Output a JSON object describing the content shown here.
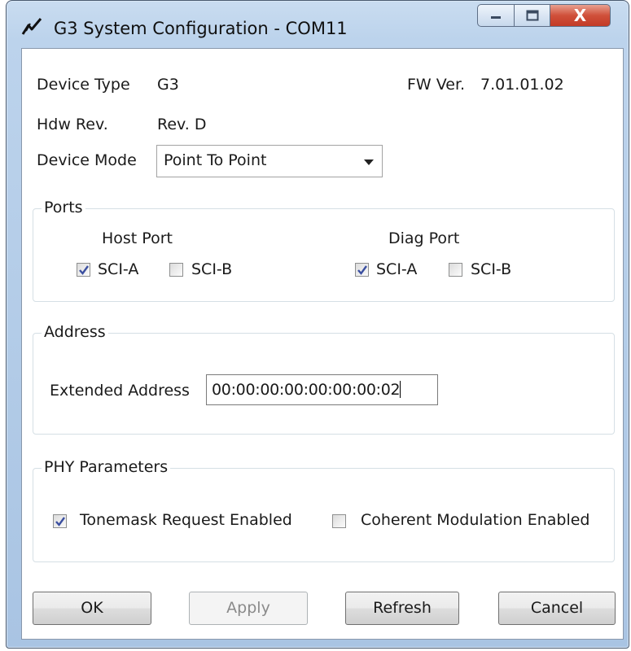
{
  "window": {
    "title": "G3 System Configuration - COM11",
    "close_glyph": "X"
  },
  "device": {
    "type_label": "Device Type",
    "type_value": "G3",
    "fw_label": "FW Ver.",
    "fw_value": "7.01.01.02",
    "hdw_label": "Hdw Rev.",
    "hdw_value": "Rev. D",
    "mode_label": "Device Mode",
    "mode_value": "Point To Point"
  },
  "ports": {
    "title": "Ports",
    "host": {
      "label": "Host Port",
      "sci_a": {
        "label": "SCI-A",
        "checked": true
      },
      "sci_b": {
        "label": "SCI-B",
        "checked": false
      }
    },
    "diag": {
      "label": "Diag Port",
      "sci_a": {
        "label": "SCI-A",
        "checked": true
      },
      "sci_b": {
        "label": "SCI-B",
        "checked": false
      }
    }
  },
  "address": {
    "title": "Address",
    "extended_label": "Extended Address",
    "extended_value": "00:00:00:00:00:00:00:02"
  },
  "phy": {
    "title": "PHY Parameters",
    "tonemask": {
      "label": "Tonemask Request Enabled",
      "checked": true
    },
    "coherent": {
      "label": "Coherent Modulation Enabled",
      "checked": false
    }
  },
  "buttons": {
    "ok": "OK",
    "apply": "Apply",
    "refresh": "Refresh",
    "cancel": "Cancel"
  },
  "colors": {
    "check_mark": "#3b4fa0",
    "close_button": "#c8432e",
    "title_gradient": "#bcd3ec"
  }
}
